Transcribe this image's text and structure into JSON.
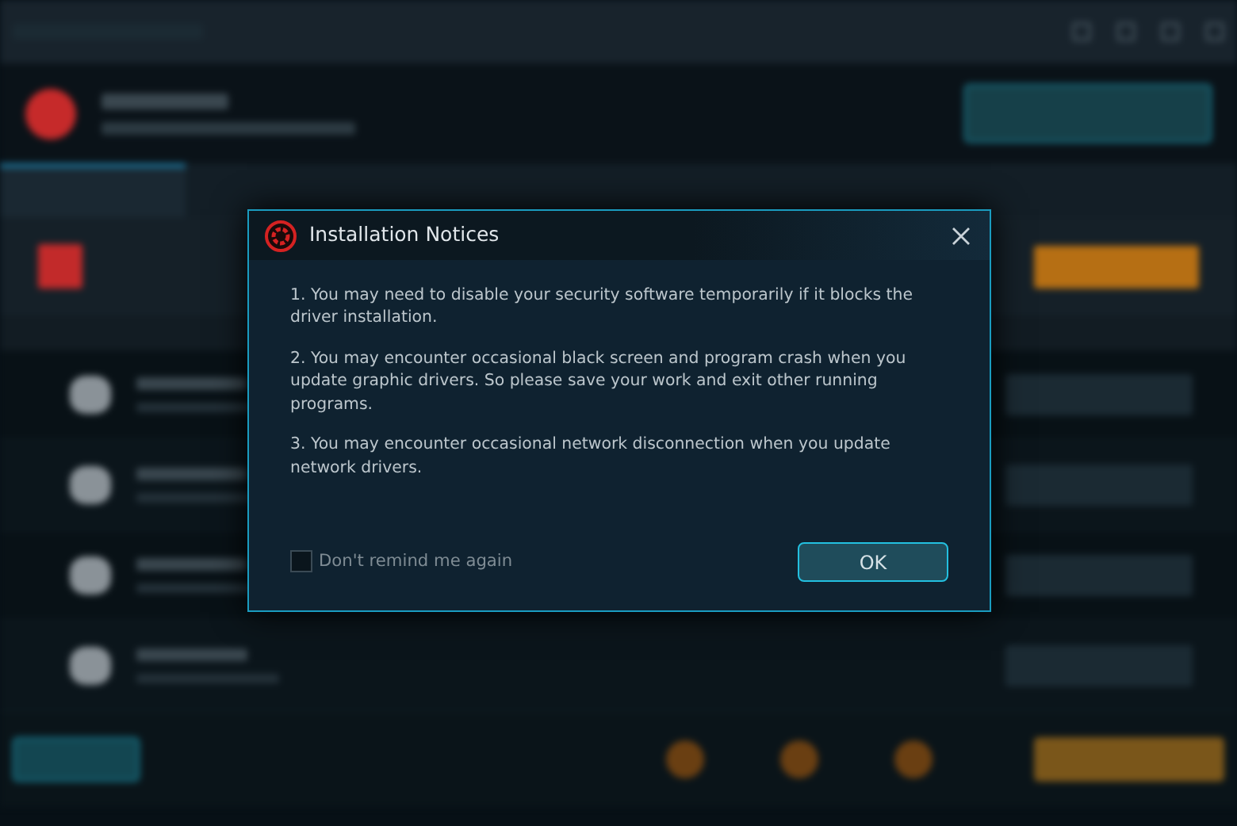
{
  "dialog": {
    "title": "Installation Notices",
    "notices": [
      "1. You may need to disable your security software temporarily if it blocks the driver installation.",
      "2. You may encounter occasional black screen and program crash when you update graphic drivers. So please save your work and exit other running programs.",
      "3. You may encounter occasional network disconnection when you update network drivers."
    ],
    "dont_remind": {
      "label": "Don't remind me again",
      "checked": false
    },
    "ok_button": "OK"
  }
}
